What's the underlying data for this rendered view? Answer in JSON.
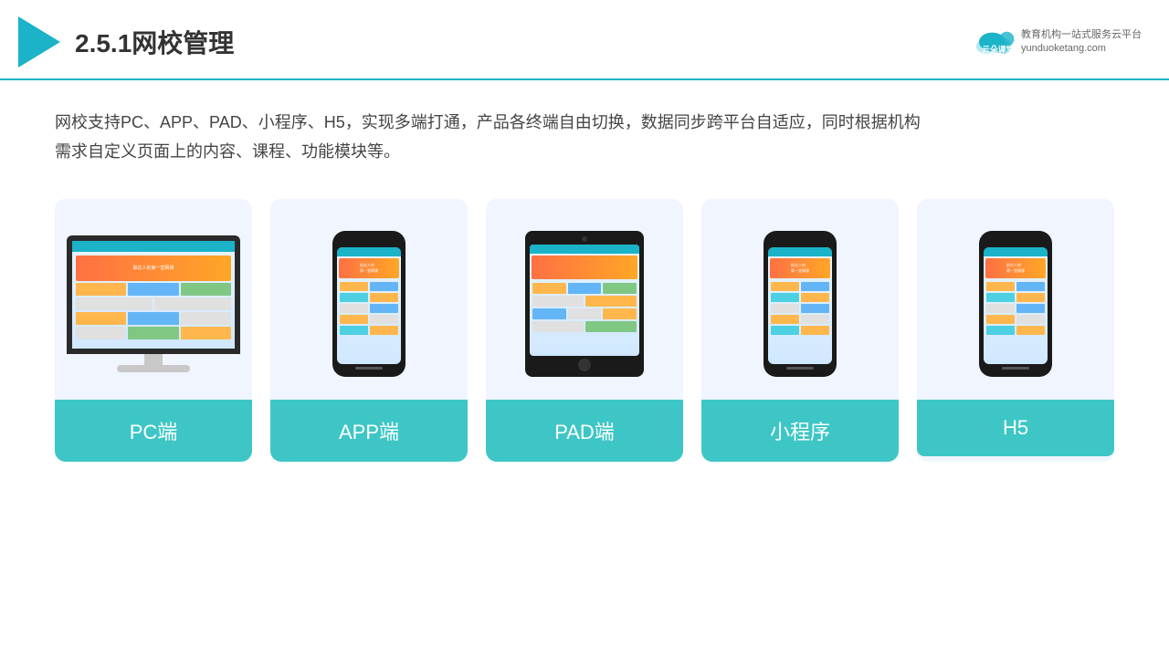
{
  "header": {
    "title": "2.5.1网校管理",
    "brand": {
      "name": "云朵课堂",
      "domain": "yunduoketang.com",
      "tagline": "教育机构一站式服务云平台"
    }
  },
  "description": "网校支持PC、APP、PAD、小程序、H5，实现多端打通，产品各终端自由切换，数据同步跨平台自适应，同时根据机构\n需求自定义页面上的内容、课程、功能模块等。",
  "cards": [
    {
      "id": "pc",
      "label": "PC端"
    },
    {
      "id": "app",
      "label": "APP端"
    },
    {
      "id": "pad",
      "label": "PAD端"
    },
    {
      "id": "miniapp",
      "label": "小程序"
    },
    {
      "id": "h5",
      "label": "H5"
    }
  ],
  "colors": {
    "accent": "#1ab3c8",
    "card_bg": "#f0f5ff",
    "card_label_bg": "#3ec6c6"
  }
}
